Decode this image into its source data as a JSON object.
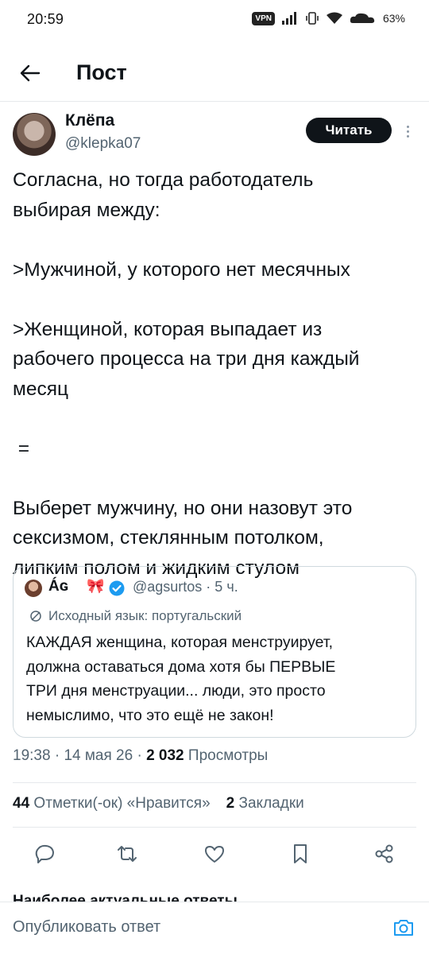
{
  "status_bar": {
    "time": "20:59",
    "vpn": "VPN",
    "battery": "63%"
  },
  "header": {
    "title": "Пост"
  },
  "post": {
    "author_name": "Клёпа",
    "author_handle": "@klepka07",
    "follow_label": "Читать",
    "text_lines": [
      "Согласна, но тогда работодатель",
      "выбирая между:",
      "",
      ">Мужчиной, у которого нет месячных",
      "",
      ">Женщиной, которая выпадает из",
      "рабочего процесса на три дня каждый",
      "месяц",
      "",
      " =",
      "",
      "Выберет мужчину, но они назовут это",
      "сексизмом, стеклянным потолком,",
      "липким полом и жидким стулом"
    ],
    "quote": {
      "name": "Áɢ",
      "emoji": "🎀",
      "meta": "@agsurtos · 5 ч.",
      "translation_note": "Исходный язык: португальский",
      "text_lines": [
        "КАЖДАЯ женщина, которая менструирует,",
        "должна оставаться дома хотя бы ПЕРВЫЕ",
        "ТРИ дня менструации... люди, это просто",
        "немыслимо, что это ещё не закон!"
      ]
    },
    "time": "19:38",
    "date": "14 мая 26",
    "views_count": "2 032",
    "views_label": "Просмотры",
    "likes_count": "44",
    "likes_label": "Отметки(-ок) «Нравится»",
    "bookmarks_count": "2",
    "bookmarks_label": "Закладки"
  },
  "actions": [
    "reply-icon",
    "retweet-icon",
    "like-icon",
    "bookmark-icon",
    "share-icon"
  ],
  "partial_section_heading": "Наиболее актуальные ответы",
  "reply_bar": {
    "placeholder": "Опубликовать ответ"
  },
  "colors": {
    "text": "#0f1419",
    "secondary": "#536471",
    "verified": "#1d9bf0",
    "accent": "#1d9bf0"
  }
}
